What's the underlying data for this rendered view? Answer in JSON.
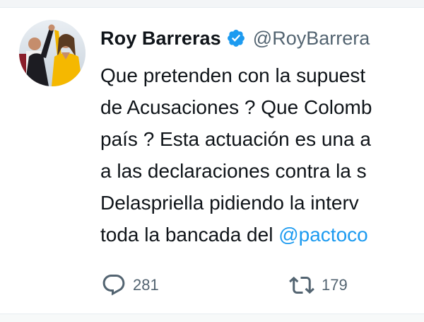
{
  "tweet": {
    "author": {
      "display_name": "Roy Barreras",
      "handle": "@RoyBarrera",
      "verified": true,
      "avatar_icon": "avatar-photo"
    },
    "text_lines": [
      "Que pretenden con la supuest",
      "de Acusaciones ? Que Colomb",
      "país ? Esta actuación es una a",
      "a las declaraciones contra la s",
      "Delaspriella pidiendo la interv"
    ],
    "last_line_prefix": "toda la bancada del ",
    "last_line_mention": "@pactoco",
    "stats": {
      "replies": "281",
      "retweets": "179"
    }
  },
  "colors": {
    "text": "#0f1419",
    "secondary": "#536471",
    "link": "#1d9bf0",
    "verified": "#1d9bf0"
  },
  "icons": {
    "reply": "reply-bubble-icon",
    "retweet": "retweet-arrows-icon",
    "verified": "verified-badge-icon"
  }
}
